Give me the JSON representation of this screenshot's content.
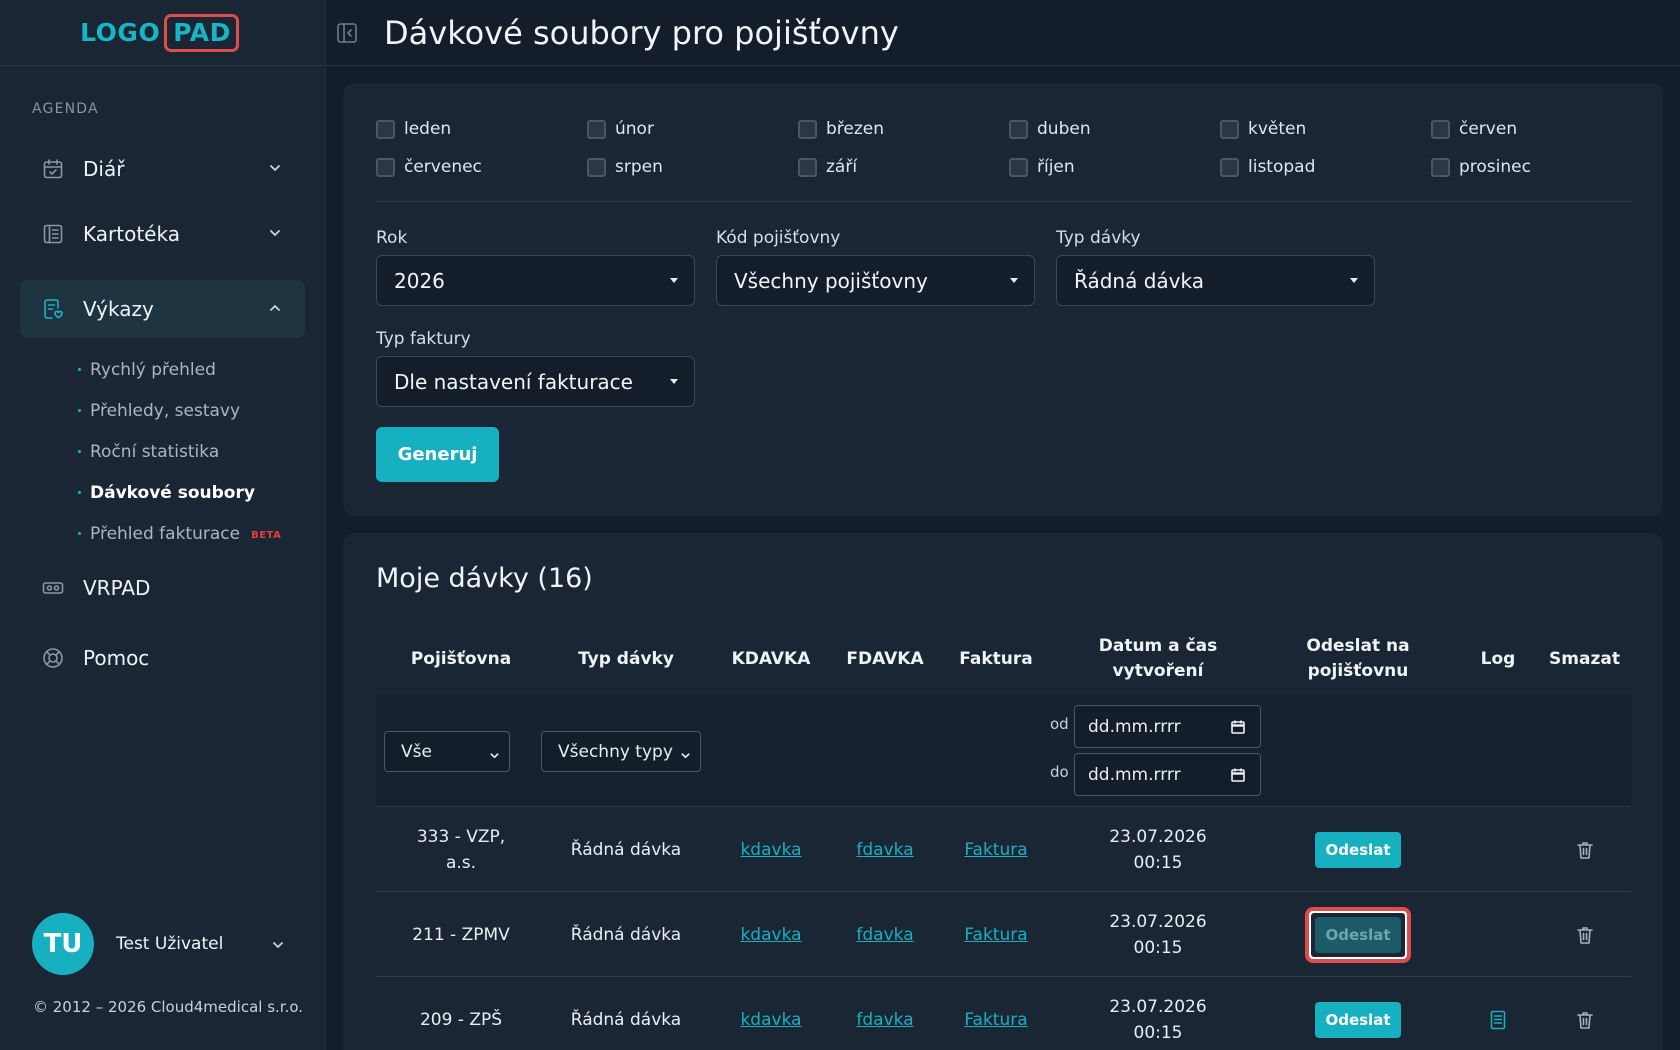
{
  "logo": {
    "part1": "LOGO",
    "part2": "PAD"
  },
  "page_title": "Dávkové soubory pro pojišťovny",
  "sidebar": {
    "section_label": "AGENDA",
    "items": [
      {
        "label": "Diář",
        "icon": "calendar-check-icon"
      },
      {
        "label": "Kartotéka",
        "icon": "card-index-icon"
      },
      {
        "label": "Výkazy",
        "icon": "report-icon"
      },
      {
        "label": "VRPAD",
        "icon": "vr-headset-icon"
      },
      {
        "label": "Pomoc",
        "icon": "lifebuoy-icon"
      }
    ],
    "subitems": [
      {
        "label": "Rychlý přehled"
      },
      {
        "label": "Přehledy, sestavy"
      },
      {
        "label": "Roční statistika"
      },
      {
        "label": "Dávkové soubory"
      },
      {
        "label": "Přehled fakturace",
        "badge": "BETA"
      }
    ]
  },
  "user": {
    "initials": "TU",
    "name": "Test Uživatel"
  },
  "copyright": "© 2012 – 2026 Cloud4medical s.r.o.",
  "filters": {
    "months": [
      "leden",
      "únor",
      "březen",
      "duben",
      "květen",
      "červen",
      "červenec",
      "srpen",
      "září",
      "říjen",
      "listopad",
      "prosinec"
    ],
    "year_label": "Rok",
    "year_value": "2026",
    "insurer_label": "Kód pojišťovny",
    "insurer_value": "Všechny pojišťovny",
    "batch_type_label": "Typ dávky",
    "batch_type_value": "Řádná dávka",
    "invoice_type_label": "Typ faktury",
    "invoice_type_value": "Dle nastavení fakturace",
    "generate_label": "Generuj"
  },
  "batches": {
    "title": "Moje dávky (16)",
    "headers": {
      "insurer": "Pojišťovna",
      "type": "Typ dávky",
      "kdavka": "KDAVKA",
      "fdavka": "FDAVKA",
      "invoice": "Faktura",
      "created_1": "Datum a čas",
      "created_2": "vytvoření",
      "send_1": "Odeslat na",
      "send_2": "pojišťovnu",
      "log": "Log",
      "delete": "Smazat"
    },
    "table_filters": {
      "insurer_value": "Vše",
      "type_value": "Všechny typy",
      "from_label": "od",
      "to_label": "do",
      "date_placeholder": "dd.mm.rrrr"
    },
    "rows": [
      {
        "insurer_1": "333 - VZP,",
        "insurer_2": "a.s.",
        "type": "Řádná dávka",
        "kdavka": "kdavka",
        "fdavka": "fdavka",
        "invoice": "Faktura",
        "date": "23.07.2026",
        "time": "00:15",
        "send": "Odeslat"
      },
      {
        "insurer_1": "211 - ZPMV",
        "insurer_2": "",
        "type": "Řádná dávka",
        "kdavka": "kdavka",
        "fdavka": "fdavka",
        "invoice": "Faktura",
        "date": "23.07.2026",
        "time": "00:15",
        "send": "Odeslat"
      },
      {
        "insurer_1": "209 - ZPŠ",
        "insurer_2": "",
        "type": "Řádná dávka",
        "kdavka": "kdavka",
        "fdavka": "fdavka",
        "invoice": "Faktura",
        "date": "23.07.2026",
        "time": "00:15",
        "send": "Odeslat"
      }
    ]
  },
  "colors": {
    "accent": "#17b0c0",
    "highlight": "#e04b4b",
    "beta": "#e53e3e"
  }
}
